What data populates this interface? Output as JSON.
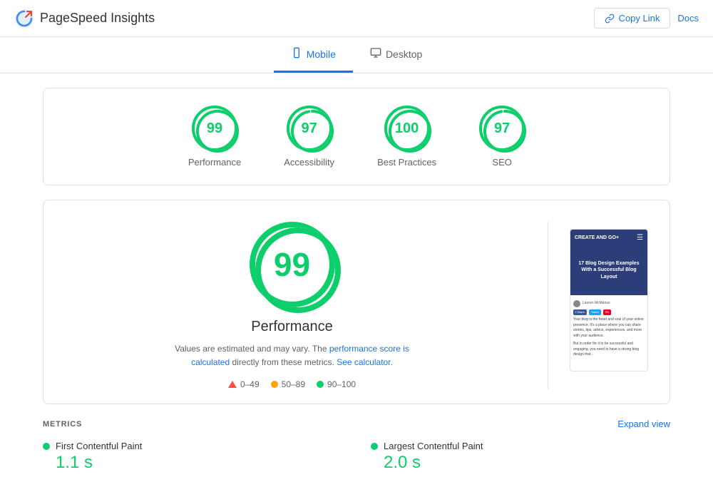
{
  "header": {
    "title": "PageSpeed Insights",
    "copy_link_label": "Copy Link",
    "docs_label": "Docs"
  },
  "tabs": [
    {
      "id": "mobile",
      "label": "Mobile",
      "active": true
    },
    {
      "id": "desktop",
      "label": "Desktop",
      "active": false
    }
  ],
  "score_cards": [
    {
      "id": "performance",
      "score": "99",
      "label": "Performance",
      "color": "green"
    },
    {
      "id": "accessibility",
      "score": "97",
      "label": "Accessibility",
      "color": "green"
    },
    {
      "id": "best-practices",
      "score": "100",
      "label": "Best Practices",
      "color": "green"
    },
    {
      "id": "seo",
      "score": "97",
      "label": "SEO",
      "color": "green"
    }
  ],
  "performance_section": {
    "score": "99",
    "title": "Performance",
    "description_prefix": "Values are estimated and may vary. The ",
    "description_link": "performance score is calculated",
    "description_suffix": " directly from these metrics. ",
    "see_calculator_link": "See calculator.",
    "legend": [
      {
        "type": "triangle",
        "range": "0–49"
      },
      {
        "type": "orange",
        "range": "50–89"
      },
      {
        "type": "green",
        "range": "90–100"
      }
    ]
  },
  "screenshot": {
    "site_name": "CREATE AND GO+",
    "article_title": "17 Blog Design Examples With a Successful Blog Layout"
  },
  "metrics": {
    "section_label": "METRICS",
    "expand_label": "Expand view",
    "items": [
      {
        "name": "First Contentful Paint",
        "value": "1.1 s",
        "color": "#0cce6b"
      },
      {
        "name": "Largest Contentful Paint",
        "value": "2.0 s",
        "color": "#0cce6b"
      }
    ]
  },
  "colors": {
    "green": "#0cce6b",
    "orange": "#ffa400",
    "red": "#ff4e42",
    "blue": "#1a73e8"
  }
}
